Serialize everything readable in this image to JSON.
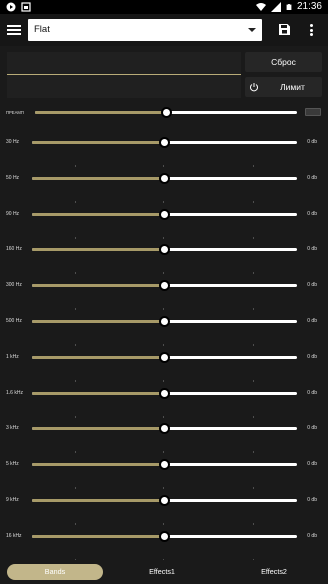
{
  "statusbar": {
    "time": "21:36",
    "left_icons": [
      "play-icon",
      "image-icon"
    ],
    "right_icons": [
      "wifi-icon",
      "signal-icon",
      "battery-icon"
    ]
  },
  "toolbar": {
    "preset_value": "Flat",
    "menu_icon": "hamburger-menu-icon",
    "save_icon": "save-icon",
    "more_icon": "more-vert-icon"
  },
  "actions": {
    "reset_label": "Сброс",
    "limit_label": "Лимит",
    "limit_icon": "power-icon"
  },
  "preamp": {
    "label": "ПРЕАМП",
    "level": 0.5
  },
  "bands": [
    {
      "label": "30 Hz",
      "value": "0 db",
      "level": 0.5
    },
    {
      "label": "50 Hz",
      "value": "0 db",
      "level": 0.5
    },
    {
      "label": "90 Hz",
      "value": "0 db",
      "level": 0.5
    },
    {
      "label": "160 Hz",
      "value": "0 db",
      "level": 0.5
    },
    {
      "label": "300 Hz",
      "value": "0 db",
      "level": 0.5
    },
    {
      "label": "500 Hz",
      "value": "0 db",
      "level": 0.5
    },
    {
      "label": "1 kHz",
      "value": "0 db",
      "level": 0.5
    },
    {
      "label": "1.6 kHz",
      "value": "0 db",
      "level": 0.5
    },
    {
      "label": "3 kHz",
      "value": "0 db",
      "level": 0.5
    },
    {
      "label": "5 kHz",
      "value": "0 db",
      "level": 0.5
    },
    {
      "label": "9 kHz",
      "value": "0 db",
      "level": 0.5
    },
    {
      "label": "16 kHz",
      "value": "0 db",
      "level": 0.5
    }
  ],
  "tabs": [
    {
      "label": "Bands",
      "active": true
    },
    {
      "label": "Effects1",
      "active": false
    },
    {
      "label": "Effects2",
      "active": false
    }
  ],
  "colors": {
    "accent": "#a79a68",
    "accent_light": "#c2b68a",
    "background": "#1a1a1a",
    "track": "#ffffff"
  }
}
